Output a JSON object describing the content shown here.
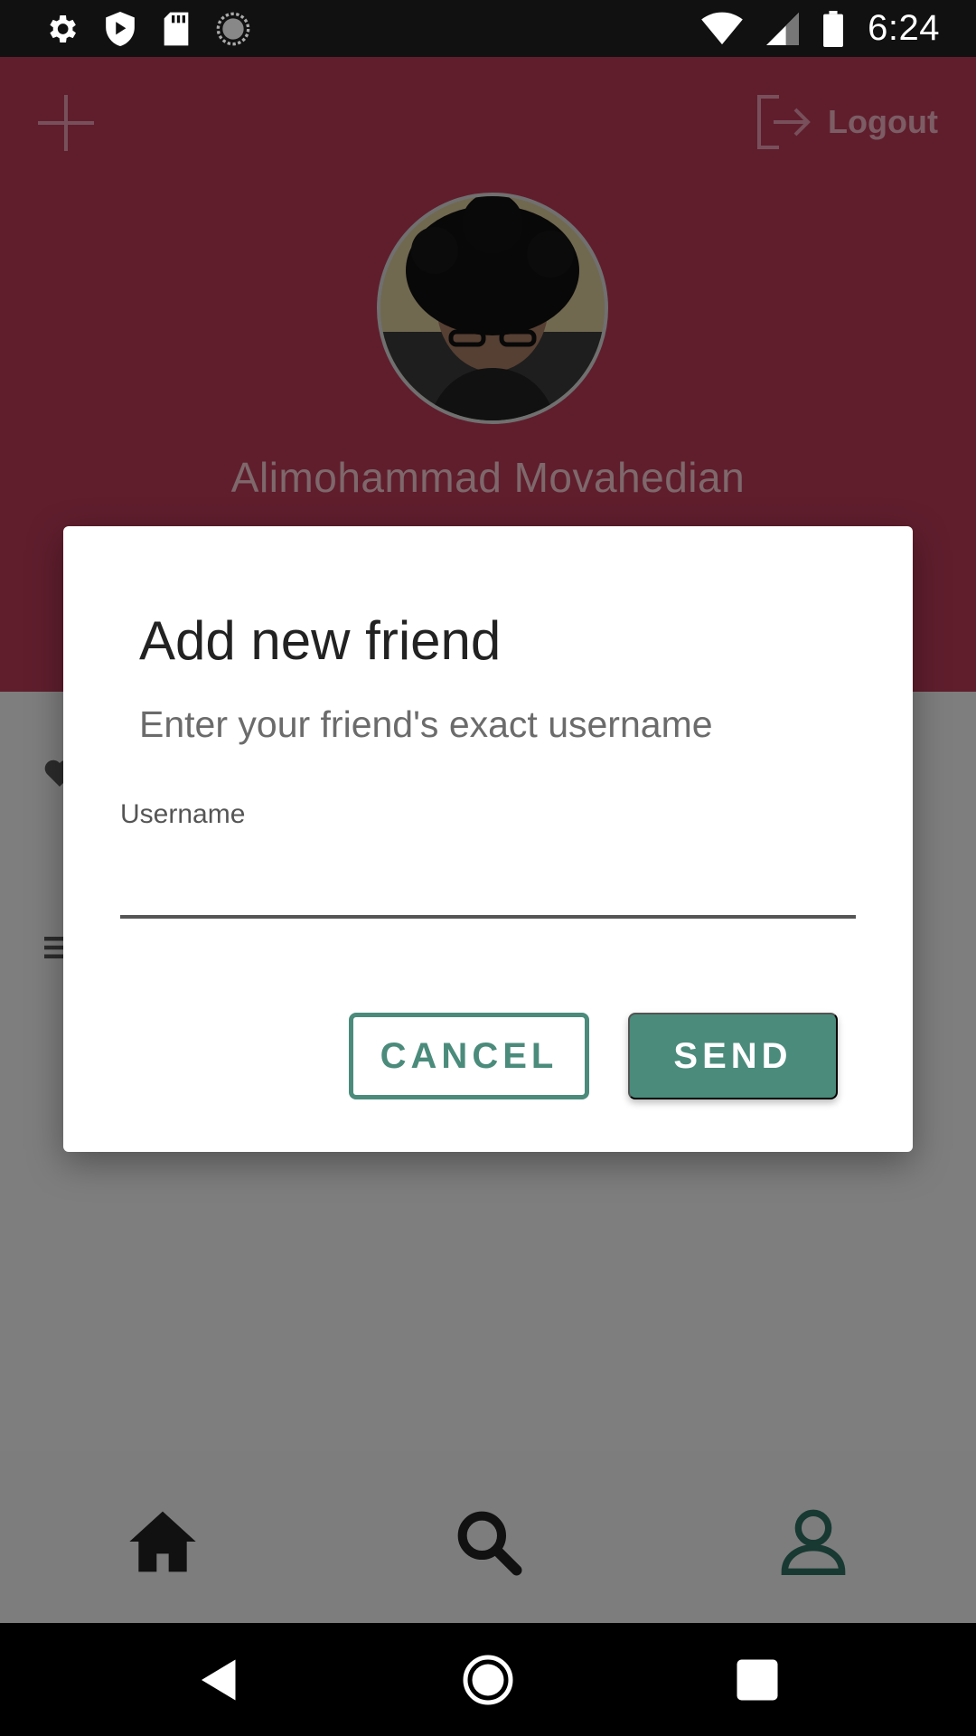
{
  "status_bar": {
    "time": "6:24",
    "icons": [
      "settings-icon",
      "shield-icon",
      "sd-card-icon",
      "sync-icon",
      "wifi-icon",
      "signal-icon",
      "battery-icon"
    ]
  },
  "header": {
    "add_icon": "plus-icon",
    "logout_label": "Logout",
    "profile_name": "Alimohammad Movahedian",
    "background_color": "#b93a56"
  },
  "dialog": {
    "title": "Add new friend",
    "subtitle": "Enter your friend's exact username",
    "field_label": "Username",
    "field_value": "",
    "cancel_label": "CANCEL",
    "send_label": "SEND",
    "accent_color": "#4b8b7b"
  },
  "bottom_nav": {
    "items": [
      "home-icon",
      "search-icon",
      "profile-icon"
    ],
    "active": "profile-icon"
  },
  "system_nav": {
    "items": [
      "back-icon",
      "home-circle-icon",
      "recents-icon"
    ]
  }
}
